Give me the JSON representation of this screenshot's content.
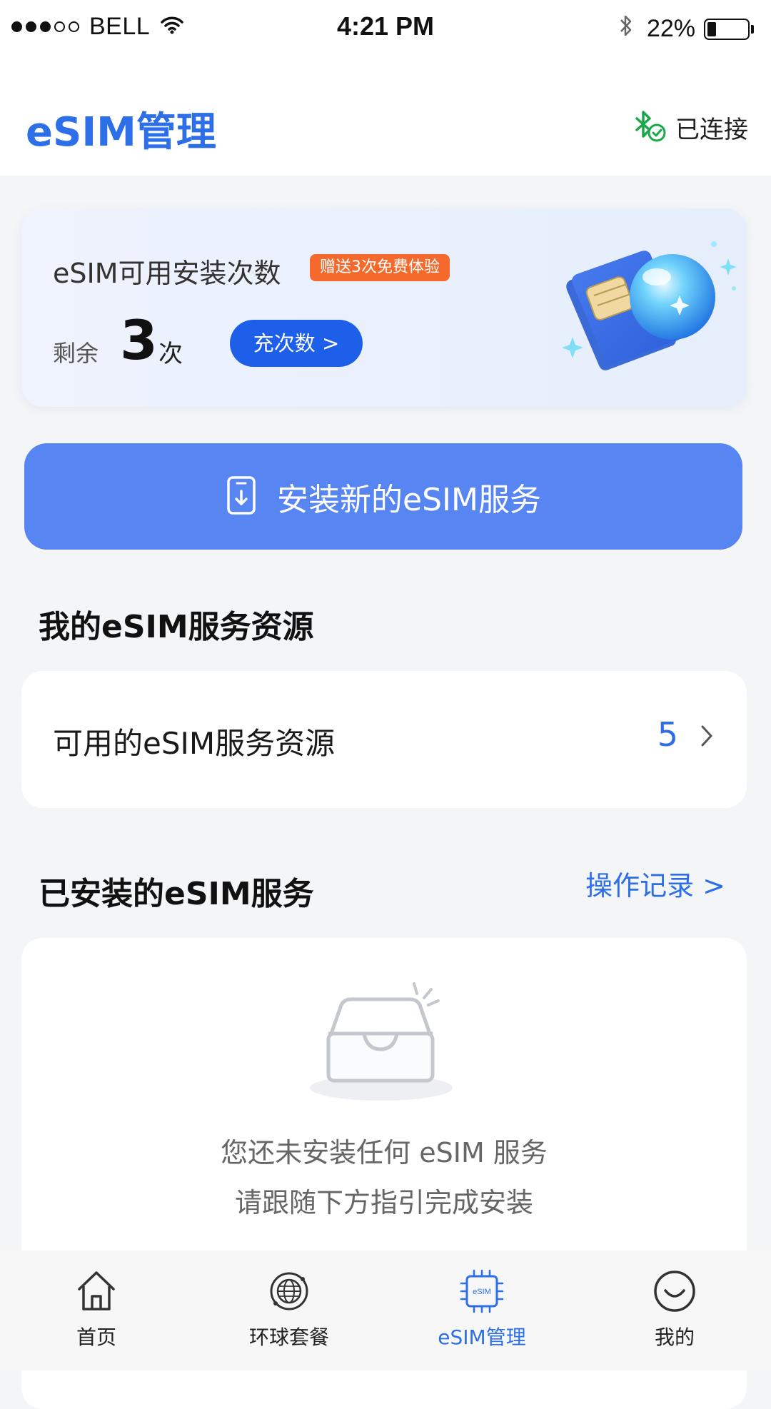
{
  "status_bar": {
    "carrier": "BELL",
    "time": "4:21 PM",
    "battery_percent": "22%",
    "battery_level": 0.22,
    "signal_bars_filled": 3,
    "signal_bars_total": 5
  },
  "header": {
    "title": "eSIM管理",
    "connection_status": "已连接"
  },
  "quota_card": {
    "title": "eSIM可用安装次数",
    "badge": "赠送3次免费体验",
    "remain_label": "剩余",
    "remain_count": "3",
    "remain_unit": "次",
    "recharge_button": "充次数 >"
  },
  "install_button": {
    "label": "安装新的eSIM服务"
  },
  "resources_section": {
    "title": "我的eSIM服务资源",
    "row_label": "可用的eSIM服务资源",
    "row_count": "5"
  },
  "installed_section": {
    "title": "已安装的eSIM服务",
    "link": "操作记录 >",
    "empty_line1": "您还未安装任何 eSIM 服务",
    "empty_line2": "请跟随下方指引完成安装"
  },
  "tab_bar": {
    "tabs": [
      {
        "label": "首页",
        "icon": "home-icon",
        "active": false
      },
      {
        "label": "环球套餐",
        "icon": "globe-icon",
        "active": false
      },
      {
        "label": "eSIM管理",
        "icon": "esim-chip-icon",
        "active": true
      },
      {
        "label": "我的",
        "icon": "smiley-icon",
        "active": false
      }
    ]
  },
  "colors": {
    "accent": "#2d6fe8",
    "install_button": "#5785f2",
    "badge": "#f56a2c",
    "connected_green": "#1aa84a",
    "background": "#f4f5f7"
  }
}
